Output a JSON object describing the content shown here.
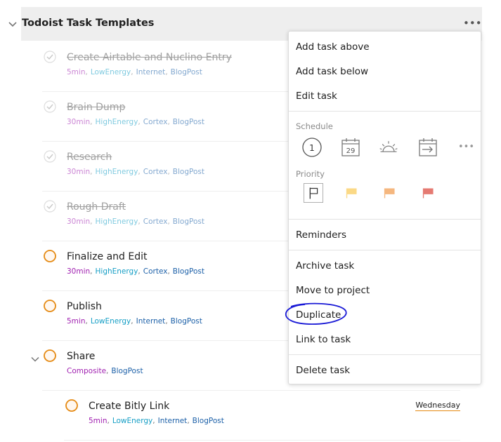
{
  "project": {
    "title": "Todoist Task Templates"
  },
  "tasks": [
    {
      "title": "Create Airtable and Nuclino Entry",
      "done": true,
      "labels": [
        "5min",
        "LowEnergy",
        "Internet",
        "BlogPost"
      ]
    },
    {
      "title": "Brain Dump",
      "done": true,
      "labels": [
        "30min",
        "HighEnergy",
        "Cortex",
        "BlogPost"
      ]
    },
    {
      "title": "Research",
      "done": true,
      "labels": [
        "30min",
        "HighEnergy",
        "Cortex",
        "BlogPost"
      ]
    },
    {
      "title": "Rough Draft",
      "done": true,
      "labels": [
        "30min",
        "HighEnergy",
        "Cortex",
        "BlogPost"
      ]
    },
    {
      "title": "Finalize and Edit",
      "done": false,
      "labels": [
        "30min",
        "HighEnergy",
        "Cortex",
        "BlogPost"
      ]
    },
    {
      "title": "Publish",
      "done": false,
      "labels": [
        "5min",
        "LowEnergy",
        "Internet",
        "BlogPost"
      ]
    },
    {
      "title": "Share",
      "done": false,
      "labels": [
        "Composite",
        "BlogPost"
      ]
    },
    {
      "title": "Create Bitly Link",
      "done": false,
      "labels": [
        "5min",
        "LowEnergy",
        "Internet",
        "BlogPost"
      ],
      "due": "Wednesday"
    }
  ],
  "menu": {
    "add_above": "Add task above",
    "add_below": "Add task below",
    "edit": "Edit task",
    "schedule_label": "Schedule",
    "today_num": "1",
    "tomorrow_num": "29",
    "priority_label": "Priority",
    "reminders": "Reminders",
    "archive": "Archive task",
    "move": "Move to project",
    "duplicate": "Duplicate",
    "link": "Link to task",
    "delete": "Delete task"
  },
  "colors": {
    "accent_orange": "#e58a13",
    "priority1": "#d1453b",
    "priority2": "#eb8909",
    "priority3": "#f9bf27",
    "annotation": "#1a1ad6"
  }
}
